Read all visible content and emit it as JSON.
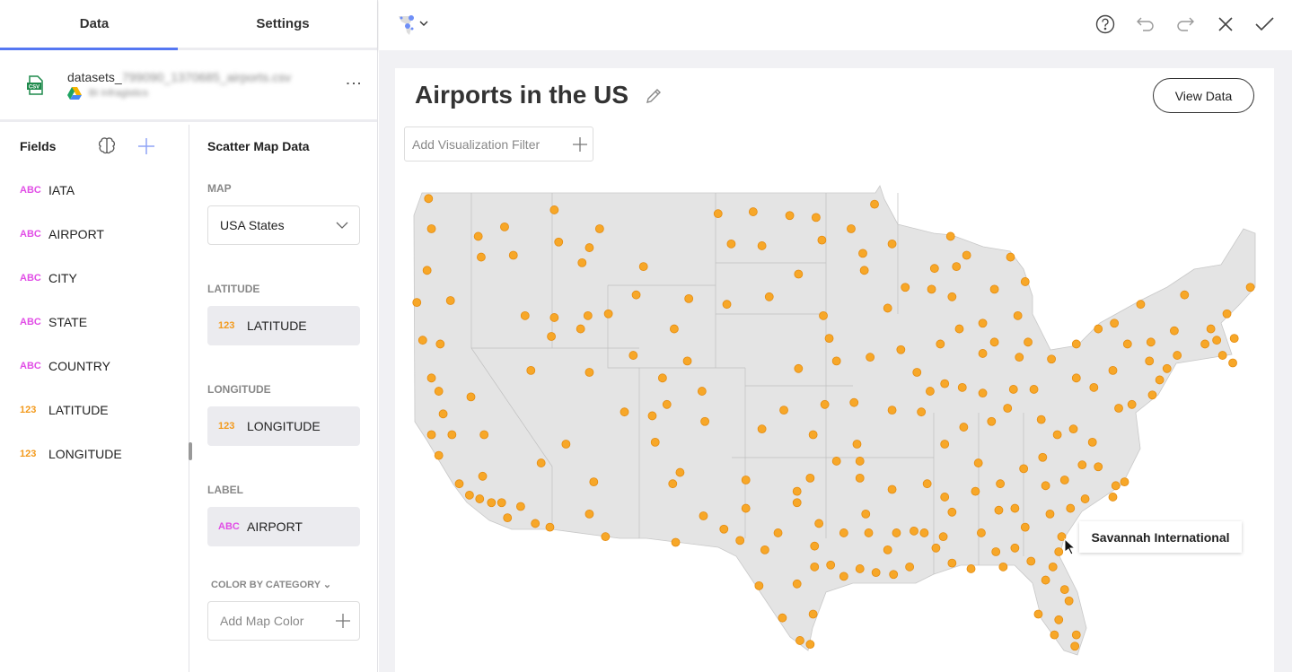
{
  "tabs": [
    "Data",
    "Settings"
  ],
  "dataset": {
    "name_prefix": "datasets_",
    "name_blurred": "799090_1370685_airports.csv",
    "source": "BI Infragistics"
  },
  "fields": {
    "title": "Fields",
    "items": [
      {
        "type": "ABC",
        "name": "IATA"
      },
      {
        "type": "ABC",
        "name": "AIRPORT"
      },
      {
        "type": "ABC",
        "name": "CITY"
      },
      {
        "type": "ABC",
        "name": "STATE"
      },
      {
        "type": "ABC",
        "name": "COUNTRY"
      },
      {
        "type": "123",
        "name": "LATITUDE"
      },
      {
        "type": "123",
        "name": "LONGITUDE"
      }
    ]
  },
  "config": {
    "title": "Scatter Map Data",
    "map_label": "MAP",
    "map_value": "USA States",
    "lat_label": "LATITUDE",
    "lat_type": "123",
    "lat_value": "LATITUDE",
    "lon_label": "LONGITUDE",
    "lon_type": "123",
    "lon_value": "LONGITUDE",
    "label_label": "LABEL",
    "label_type": "ABC",
    "label_value": "AIRPORT",
    "color_label": "COLOR BY CATEGORY",
    "color_placeholder": "Add Map Color"
  },
  "card": {
    "title": "Airports in the US",
    "view_data": "View Data",
    "filter_placeholder": "Add Visualization Filter"
  },
  "tooltip": "Savannah International",
  "colors": {
    "accent": "#5577f2",
    "point": "#f7a728",
    "land": "#e4e4e4"
  },
  "points": [
    [
      -123.5,
      48.7
    ],
    [
      -123.3,
      47.1
    ],
    [
      -123.6,
      44.9
    ],
    [
      -124.3,
      43.2
    ],
    [
      -123.9,
      41.2
    ],
    [
      -122.7,
      41.0
    ],
    [
      -123.3,
      39.2
    ],
    [
      -122.8,
      38.5
    ],
    [
      -122.5,
      37.3
    ],
    [
      -123.3,
      36.2
    ],
    [
      -122.8,
      35.1
    ],
    [
      -121.9,
      36.2
    ],
    [
      -121.4,
      33.6
    ],
    [
      -120.7,
      33.0
    ],
    [
      -120.0,
      32.8
    ],
    [
      -119.2,
      32.6
    ],
    [
      -118.5,
      32.6
    ],
    [
      -118.1,
      31.8
    ],
    [
      -117.2,
      32.4
    ],
    [
      -116.2,
      31.5
    ],
    [
      -115.2,
      31.3
    ],
    [
      -120.6,
      38.2
    ],
    [
      -120.1,
      46.7
    ],
    [
      -119.9,
      45.6
    ],
    [
      -118.3,
      47.2
    ],
    [
      -117.7,
      45.7
    ],
    [
      -122.0,
      43.3
    ],
    [
      -116.9,
      42.5
    ],
    [
      -115.1,
      41.4
    ],
    [
      -114.9,
      42.4
    ],
    [
      -113.1,
      41.8
    ],
    [
      -112.6,
      42.5
    ],
    [
      -111.2,
      42.6
    ],
    [
      -114.9,
      48.1
    ],
    [
      -114.6,
      46.4
    ],
    [
      -112.5,
      46.1
    ],
    [
      -111.8,
      47.1
    ],
    [
      -113.0,
      45.3
    ],
    [
      -108.8,
      45.1
    ],
    [
      -109.3,
      43.6
    ],
    [
      -105.7,
      43.4
    ],
    [
      -106.7,
      41.8
    ],
    [
      -109.5,
      40.4
    ],
    [
      -105.8,
      40.1
    ],
    [
      -107.5,
      39.2
    ],
    [
      -107.2,
      37.8
    ],
    [
      -108.2,
      37.2
    ],
    [
      -110.1,
      37.4
    ],
    [
      -112.5,
      39.5
    ],
    [
      -116.5,
      39.6
    ],
    [
      -119.7,
      36.2
    ],
    [
      -119.8,
      34.0
    ],
    [
      -115.8,
      34.7
    ],
    [
      -114.1,
      35.7
    ],
    [
      -112.2,
      33.7
    ],
    [
      -112.5,
      32.0
    ],
    [
      -111.4,
      30.8
    ],
    [
      -108.0,
      35.8
    ],
    [
      -106.3,
      34.2
    ],
    [
      -106.8,
      33.6
    ],
    [
      -104.8,
      38.5
    ],
    [
      -104.6,
      36.9
    ],
    [
      -104.7,
      31.9
    ],
    [
      -106.6,
      30.5
    ],
    [
      -103.7,
      47.9
    ],
    [
      -101.3,
      48.0
    ],
    [
      -98.8,
      47.8
    ],
    [
      -97.0,
      47.7
    ],
    [
      -93.0,
      48.4
    ],
    [
      -102.8,
      46.3
    ],
    [
      -100.7,
      46.2
    ],
    [
      -96.6,
      46.5
    ],
    [
      -98.2,
      44.7
    ],
    [
      -100.2,
      43.5
    ],
    [
      -103.1,
      43.1
    ],
    [
      -96.5,
      42.5
    ],
    [
      -96.1,
      41.3
    ],
    [
      -98.2,
      39.7
    ],
    [
      -95.6,
      40.1
    ],
    [
      -94.4,
      37.9
    ],
    [
      -96.4,
      37.8
    ],
    [
      -99.2,
      37.5
    ],
    [
      -100.7,
      36.5
    ],
    [
      -97.2,
      36.2
    ],
    [
      -94.2,
      35.7
    ],
    [
      -91.8,
      37.5
    ],
    [
      -93.3,
      40.3
    ],
    [
      -91.2,
      40.7
    ],
    [
      -89.8,
      37.4
    ],
    [
      -88.2,
      35.7
    ],
    [
      -94.6,
      47.1
    ],
    [
      -91.8,
      46.3
    ],
    [
      -93.8,
      45.8
    ],
    [
      -93.7,
      44.9
    ],
    [
      -92.1,
      42.9
    ],
    [
      -90.9,
      44.0
    ],
    [
      -88.9,
      45.0
    ],
    [
      -87.4,
      45.1
    ],
    [
      -86.7,
      45.7
    ],
    [
      -87.8,
      46.7
    ],
    [
      -89.1,
      43.9
    ],
    [
      -87.7,
      43.5
    ],
    [
      -87.2,
      41.8
    ],
    [
      -88.5,
      41.0
    ],
    [
      -85.6,
      42.1
    ],
    [
      -84.8,
      43.9
    ],
    [
      -83.7,
      45.6
    ],
    [
      -82.7,
      44.3
    ],
    [
      -83.2,
      42.5
    ],
    [
      -84.8,
      41.1
    ],
    [
      -82.5,
      41.1
    ],
    [
      -83.1,
      40.3
    ],
    [
      -85.6,
      40.5
    ],
    [
      -85.6,
      38.4
    ],
    [
      -83.5,
      38.6
    ],
    [
      -82.1,
      38.6
    ],
    [
      -83.9,
      37.6
    ],
    [
      -85.0,
      36.9
    ],
    [
      -86.9,
      36.6
    ],
    [
      -81.6,
      37.0
    ],
    [
      -79.2,
      39.2
    ],
    [
      -80.9,
      40.2
    ],
    [
      -79.2,
      41.0
    ],
    [
      -77.7,
      41.8
    ],
    [
      -76.6,
      42.1
    ],
    [
      -74.8,
      43.1
    ],
    [
      -75.7,
      41.0
    ],
    [
      -74.1,
      41.1
    ],
    [
      -72.5,
      41.7
    ],
    [
      -71.8,
      43.6
    ],
    [
      -70.0,
      41.8
    ],
    [
      -68.9,
      42.6
    ],
    [
      -67.3,
      44.0
    ],
    [
      -68.4,
      41.3
    ],
    [
      -69.6,
      41.2
    ],
    [
      -70.4,
      41.0
    ],
    [
      -69.2,
      40.4
    ],
    [
      -68.5,
      40.0
    ],
    [
      -72.3,
      40.4
    ],
    [
      -73.0,
      39.7
    ],
    [
      -74.2,
      40.1
    ],
    [
      -73.5,
      39.1
    ],
    [
      -74.0,
      38.3
    ],
    [
      -75.4,
      37.8
    ],
    [
      -76.3,
      37.6
    ],
    [
      -76.7,
      39.6
    ],
    [
      -78.0,
      38.7
    ],
    [
      -79.4,
      36.5
    ],
    [
      -78.1,
      35.8
    ],
    [
      -80.5,
      36.2
    ],
    [
      -81.5,
      35.0
    ],
    [
      -82.8,
      34.4
    ],
    [
      -85.9,
      34.7
    ],
    [
      -89.4,
      33.6
    ],
    [
      -88.2,
      32.9
    ],
    [
      -87.7,
      32.1
    ],
    [
      -86.1,
      33.2
    ],
    [
      -84.4,
      33.6
    ],
    [
      -81.3,
      33.5
    ],
    [
      -80.0,
      33.8
    ],
    [
      -78.8,
      34.6
    ],
    [
      -77.7,
      34.5
    ],
    [
      -76.5,
      33.5
    ],
    [
      -75.9,
      33.7
    ],
    [
      -76.7,
      32.9
    ],
    [
      -78.6,
      32.8
    ],
    [
      -79.6,
      32.3
    ],
    [
      -81.0,
      32.0
    ],
    [
      -82.7,
      31.3
    ],
    [
      -83.4,
      32.3
    ],
    [
      -84.5,
      32.2
    ],
    [
      -85.7,
      31.0
    ],
    [
      -84.7,
      30.0
    ],
    [
      -83.4,
      30.2
    ],
    [
      -82.3,
      29.5
    ],
    [
      -80.8,
      29.2
    ],
    [
      -80.2,
      30.8
    ],
    [
      -80.4,
      30.0
    ],
    [
      -81.3,
      28.5
    ],
    [
      -80.0,
      28.0
    ],
    [
      -79.7,
      27.4
    ],
    [
      -81.8,
      26.7
    ],
    [
      -80.7,
      25.6
    ],
    [
      -79.2,
      25.6
    ],
    [
      -79.3,
      25.0
    ],
    [
      -80.4,
      26.4
    ],
    [
      -88.3,
      30.8
    ],
    [
      -89.6,
      31.0
    ],
    [
      -88.8,
      30.2
    ],
    [
      -87.7,
      29.4
    ],
    [
      -86.4,
      29.1
    ],
    [
      -90.6,
      29.2
    ],
    [
      -91.7,
      28.8
    ],
    [
      -92.9,
      28.9
    ],
    [
      -94.0,
      29.1
    ],
    [
      -95.1,
      28.7
    ],
    [
      -96.0,
      29.3
    ],
    [
      -97.1,
      29.2
    ],
    [
      -98.3,
      28.3
    ],
    [
      -100.9,
      28.2
    ],
    [
      -99.3,
      26.5
    ],
    [
      -98.1,
      25.3
    ],
    [
      -97.4,
      25.1
    ],
    [
      -97.2,
      26.7
    ],
    [
      -97.1,
      30.3
    ],
    [
      -96.8,
      31.5
    ],
    [
      -95.1,
      31.0
    ],
    [
      -93.4,
      31.0
    ],
    [
      -92.1,
      30.1
    ],
    [
      -91.5,
      31.0
    ],
    [
      -90.3,
      31.1
    ],
    [
      -93.6,
      32.0
    ],
    [
      -91.8,
      33.3
    ],
    [
      -94.0,
      33.9
    ],
    [
      -95.6,
      34.8
    ],
    [
      -94.0,
      34.8
    ],
    [
      -97.4,
      33.9
    ],
    [
      -98.3,
      33.2
    ],
    [
      -98.3,
      32.6
    ],
    [
      -101.8,
      32.3
    ],
    [
      -101.8,
      33.8
    ],
    [
      -102.2,
      30.6
    ],
    [
      -103.3,
      31.2
    ],
    [
      -100.5,
      30.1
    ],
    [
      -99.6,
      31.0
    ],
    [
      -87.0,
      38.7
    ],
    [
      -89.2,
      38.5
    ],
    [
      -90.1,
      39.5
    ],
    [
      -88.2,
      38.9
    ],
    [
      -84.2,
      29.2
    ]
  ]
}
